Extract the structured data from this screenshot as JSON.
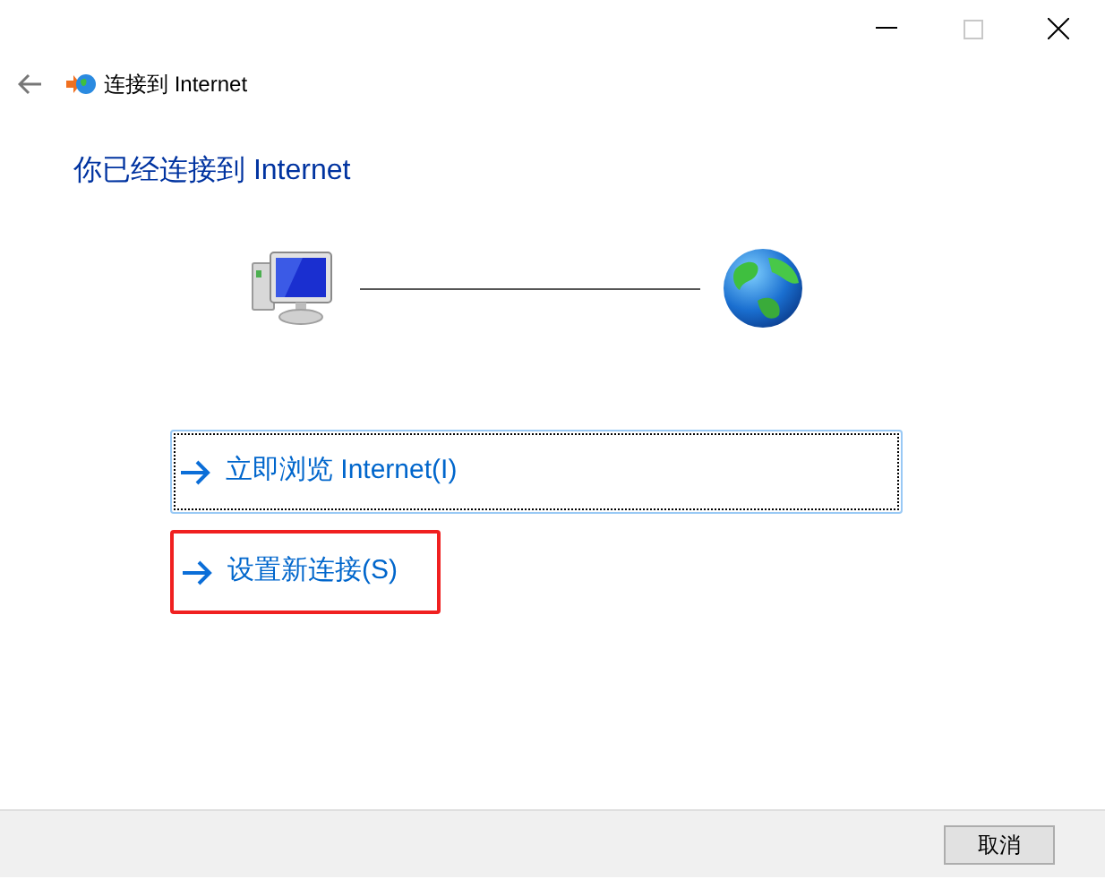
{
  "window": {
    "title": "连接到 Internet"
  },
  "heading": "你已经连接到 Internet",
  "options": [
    {
      "label": "立即浏览 Internet(I)",
      "focused": true,
      "highlighted": false
    },
    {
      "label": "设置新连接(S)",
      "focused": false,
      "highlighted": true
    }
  ],
  "buttons": [
    {
      "label": "取消"
    }
  ]
}
